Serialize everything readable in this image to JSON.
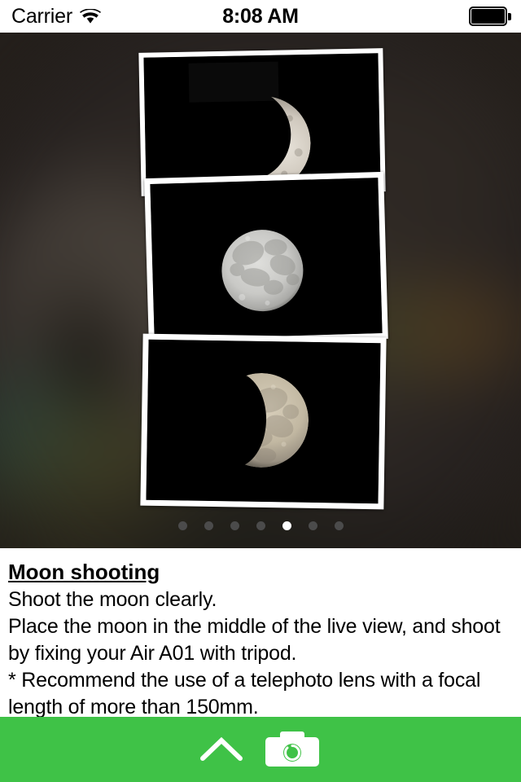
{
  "statusbar": {
    "carrier": "Carrier",
    "wifi_icon": "wifi-icon",
    "time": "8:08 AM",
    "battery_icon": "battery-full-icon"
  },
  "hero": {
    "background_color": "#241f1b",
    "photos": [
      {
        "name": "photo-crescent-moon",
        "caption": "crescent moon photograph",
        "phase": "waxing crescent"
      },
      {
        "name": "photo-full-moon",
        "caption": "full moon photograph",
        "phase": "full"
      },
      {
        "name": "photo-gibbous-moon",
        "caption": "gibbous moon photograph",
        "phase": "waning gibbous"
      }
    ],
    "pager": {
      "total": 7,
      "active_index": 4,
      "active_color": "#ffffff",
      "inactive_color": "#4b4b4b"
    }
  },
  "description": {
    "title": "Moon shooting",
    "lines": [
      "Shoot the moon clearly.",
      "Place the moon in the middle of the live view, and shoot by fixing your Air A01 with tripod.",
      "* Recommend the use of a telephoto lens with a focal length of more than 150mm."
    ]
  },
  "toolbar": {
    "background_color": "#3fc247",
    "chevron_up_label": "chevron-up-icon",
    "camera_label": "camera-icon"
  }
}
